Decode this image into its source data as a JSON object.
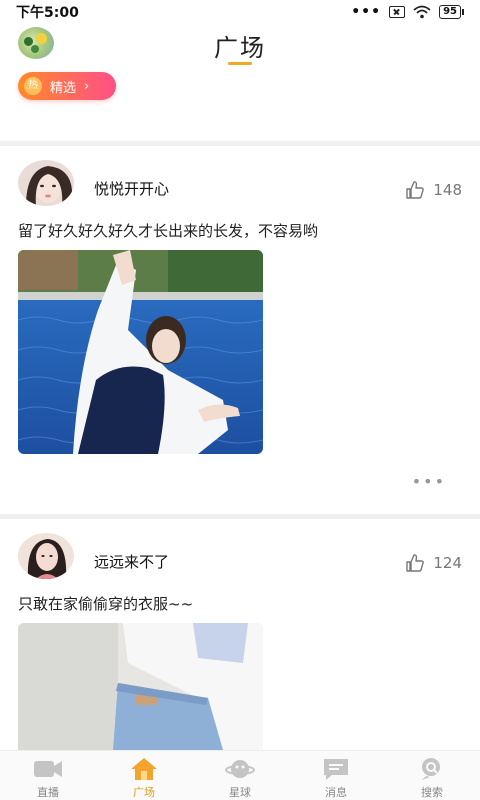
{
  "status_bar": {
    "time": "下午5:00",
    "more": "•••",
    "battery": "95"
  },
  "header": {
    "title": "广场"
  },
  "featured": {
    "icon_text": "热",
    "label": "精选",
    "chevron": "›"
  },
  "posts": [
    {
      "username": "悦悦开开心",
      "likes": "148",
      "text": "留了好久好久好久才长出来的长发，不容易哟",
      "more": "•••"
    },
    {
      "username": "远远来不了",
      "likes": "124",
      "text": "只敢在家偷偷穿的衣服~~"
    }
  ],
  "tabs": [
    {
      "label": "直播",
      "icon": "video-icon",
      "active": false
    },
    {
      "label": "广场",
      "icon": "home-icon",
      "active": true
    },
    {
      "label": "星球",
      "icon": "planet-icon",
      "active": false
    },
    {
      "label": "消息",
      "icon": "message-icon",
      "active": false
    },
    {
      "label": "搜索",
      "icon": "search-icon",
      "active": false
    }
  ],
  "colors": {
    "accent": "#f6a623",
    "pill_start": "#ff8a2b",
    "pill_end": "#ff4f87",
    "tab_active": "#e39a1a"
  }
}
